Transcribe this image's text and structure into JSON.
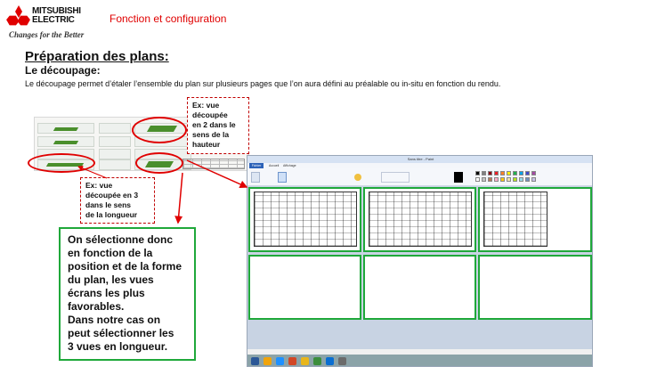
{
  "header": {
    "brand_line1": "MITSUBISHI",
    "brand_line2": "ELECTRIC",
    "tagline": "Changes for the Better",
    "section": "Fonction et configuration"
  },
  "title": "Préparation des plans:",
  "subtitle": "Le découpage:",
  "description": "Le découpage permet d’étaler l’ensemble du plan sur plusieurs pages que l’on aura défini au préalable ou in-situ en fonction du rendu.",
  "callout_vertical": {
    "line1": "Ex: vue",
    "line2": "découpée",
    "line3": "en 2 dans le",
    "line4": "sens de la",
    "line5": "hauteur"
  },
  "callout_horizontal": {
    "line1": "Ex: vue",
    "line2": "découpée en 3",
    "line3": "dans le sens",
    "line4": "de la longueur"
  },
  "select_box": {
    "line1": "On sélectionne donc",
    "line2": "en fonction de la",
    "line3": "position et de la forme",
    "line4": "du plan, les vues",
    "line5": "écrans les plus",
    "line6": "favorables.",
    "line7": "Dans notre cas on",
    "line8": "peut sélectionner les",
    "line9": " 3 vues en longueur."
  },
  "colors": {
    "brand_red": "#e00000",
    "highlight_green": "#1fa83a",
    "callout_border": "#c00000"
  },
  "paint": {
    "window_title": "Sans titre - Paint",
    "tab_file": "Fichier",
    "tab_home": "Accueil",
    "tab_view": "Affichage"
  }
}
